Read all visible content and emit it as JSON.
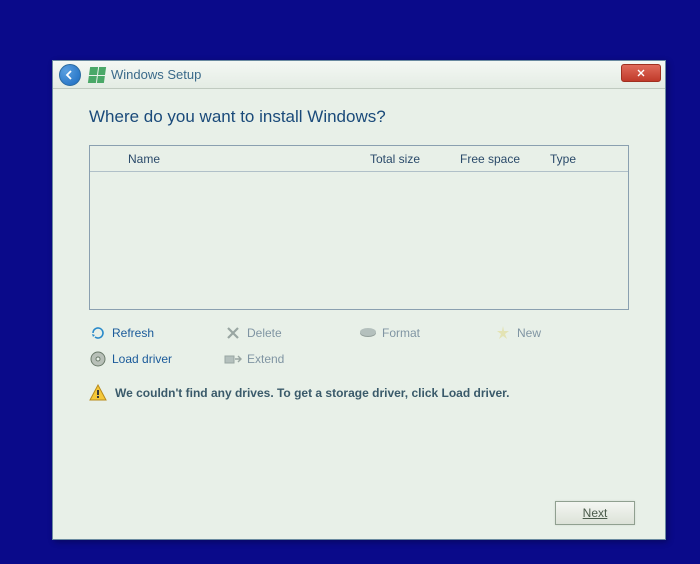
{
  "titlebar": {
    "title": "Windows Setup"
  },
  "heading": "Where do you want to install Windows?",
  "columns": {
    "name": "Name",
    "total_size": "Total size",
    "free_space": "Free space",
    "type": "Type"
  },
  "drives": [],
  "toolbar": {
    "refresh": "Refresh",
    "delete": "Delete",
    "format": "Format",
    "new": "New",
    "load_driver": "Load driver",
    "extend": "Extend"
  },
  "warning": "We couldn't find any drives. To get a storage driver, click Load driver.",
  "footer": {
    "next": "Next"
  }
}
